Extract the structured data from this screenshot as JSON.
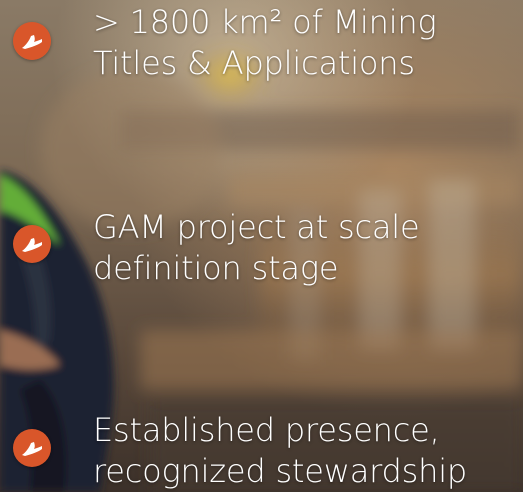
{
  "colors": {
    "accent": "#d9562a",
    "text": "#ffffff"
  },
  "icon": "company-logo-icon",
  "bullets": [
    {
      "line1": "> 1800 km² of Mining",
      "line2": "Titles & Applications"
    },
    {
      "line1": "GAM project at scale",
      "line2": "definition stage"
    },
    {
      "line1": "Established presence,",
      "line2": "recognized stewardship"
    }
  ]
}
